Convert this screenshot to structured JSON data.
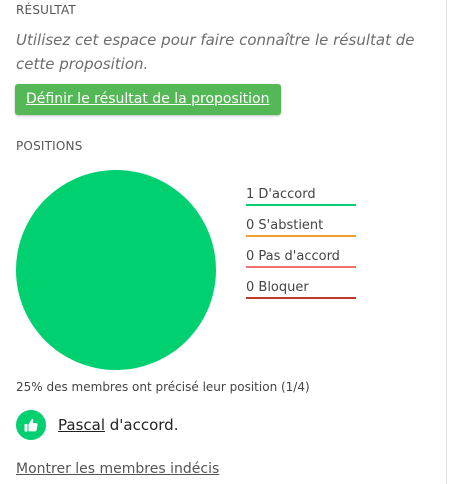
{
  "result": {
    "heading": "RÉSULTAT",
    "placeholder": "Utilisez cet espace pour faire connaître le résultat de cette proposition.",
    "define_button": "Définir le résultat de la proposition"
  },
  "positions": {
    "heading": "POSITIONS",
    "legend": [
      {
        "label": "1 D'accord",
        "color": "#00d070"
      },
      {
        "label": "0 S'abstient",
        "color": "#f0a030"
      },
      {
        "label": "0 Pas d'accord",
        "color": "#f07070"
      },
      {
        "label": "0 Bloquer",
        "color": "#c0392b"
      }
    ],
    "summary": "25% des membres ont précisé leur position (1/4)",
    "votes": [
      {
        "name": "Pascal",
        "text": " d'accord.",
        "icon": "thumbs-up-icon"
      }
    ],
    "show_undecided": "Montrer les membres indécis"
  },
  "chart_data": {
    "type": "pie",
    "categories": [
      "D'accord",
      "S'abstient",
      "Pas d'accord",
      "Bloquer"
    ],
    "values": [
      1,
      0,
      0,
      0
    ],
    "colors": [
      "#00d070",
      "#f0a030",
      "#f07070",
      "#c0392b"
    ],
    "legend": "right"
  }
}
